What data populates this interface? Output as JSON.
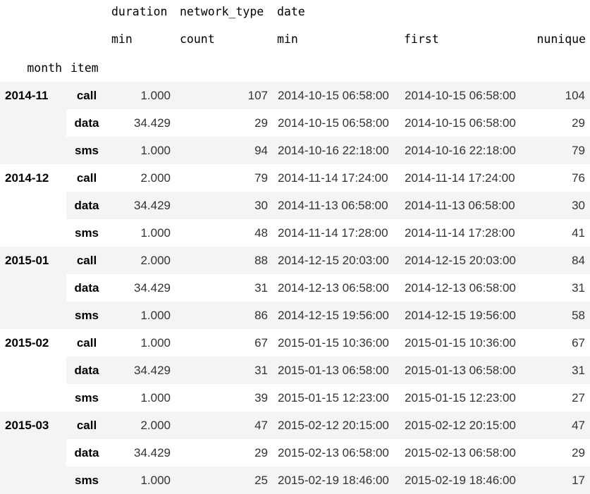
{
  "header": {
    "level0": {
      "duration": "duration",
      "network_type": "network_type",
      "date": "date"
    },
    "level1": {
      "duration_min": "min",
      "network_count": "count",
      "date_min": "min",
      "date_first": "first",
      "date_nunique": "nunique"
    },
    "index_names": {
      "month": "month",
      "item": "item"
    }
  },
  "groups": [
    {
      "month": "2014-11",
      "rows": [
        {
          "item": "call",
          "duration_min": "1.000",
          "count": "107",
          "date_min": "2014-10-15 06:58:00",
          "date_first": "2014-10-15 06:58:00",
          "nunique": "104"
        },
        {
          "item": "data",
          "duration_min": "34.429",
          "count": "29",
          "date_min": "2014-10-15 06:58:00",
          "date_first": "2014-10-15 06:58:00",
          "nunique": "29"
        },
        {
          "item": "sms",
          "duration_min": "1.000",
          "count": "94",
          "date_min": "2014-10-16 22:18:00",
          "date_first": "2014-10-16 22:18:00",
          "nunique": "79"
        }
      ]
    },
    {
      "month": "2014-12",
      "rows": [
        {
          "item": "call",
          "duration_min": "2.000",
          "count": "79",
          "date_min": "2014-11-14 17:24:00",
          "date_first": "2014-11-14 17:24:00",
          "nunique": "76"
        },
        {
          "item": "data",
          "duration_min": "34.429",
          "count": "30",
          "date_min": "2014-11-13 06:58:00",
          "date_first": "2014-11-13 06:58:00",
          "nunique": "30"
        },
        {
          "item": "sms",
          "duration_min": "1.000",
          "count": "48",
          "date_min": "2014-11-14 17:28:00",
          "date_first": "2014-11-14 17:28:00",
          "nunique": "41"
        }
      ]
    },
    {
      "month": "2015-01",
      "rows": [
        {
          "item": "call",
          "duration_min": "2.000",
          "count": "88",
          "date_min": "2014-12-15 20:03:00",
          "date_first": "2014-12-15 20:03:00",
          "nunique": "84"
        },
        {
          "item": "data",
          "duration_min": "34.429",
          "count": "31",
          "date_min": "2014-12-13 06:58:00",
          "date_first": "2014-12-13 06:58:00",
          "nunique": "31"
        },
        {
          "item": "sms",
          "duration_min": "1.000",
          "count": "86",
          "date_min": "2014-12-15 19:56:00",
          "date_first": "2014-12-15 19:56:00",
          "nunique": "58"
        }
      ]
    },
    {
      "month": "2015-02",
      "rows": [
        {
          "item": "call",
          "duration_min": "1.000",
          "count": "67",
          "date_min": "2015-01-15 10:36:00",
          "date_first": "2015-01-15 10:36:00",
          "nunique": "67"
        },
        {
          "item": "data",
          "duration_min": "34.429",
          "count": "31",
          "date_min": "2015-01-13 06:58:00",
          "date_first": "2015-01-13 06:58:00",
          "nunique": "31"
        },
        {
          "item": "sms",
          "duration_min": "1.000",
          "count": "39",
          "date_min": "2015-01-15 12:23:00",
          "date_first": "2015-01-15 12:23:00",
          "nunique": "27"
        }
      ]
    },
    {
      "month": "2015-03",
      "rows": [
        {
          "item": "call",
          "duration_min": "2.000",
          "count": "47",
          "date_min": "2015-02-12 20:15:00",
          "date_first": "2015-02-12 20:15:00",
          "nunique": "47"
        },
        {
          "item": "data",
          "duration_min": "34.429",
          "count": "29",
          "date_min": "2015-02-13 06:58:00",
          "date_first": "2015-02-13 06:58:00",
          "nunique": "29"
        },
        {
          "item": "sms",
          "duration_min": "1.000",
          "count": "25",
          "date_min": "2015-02-19 18:46:00",
          "date_first": "2015-02-19 18:46:00",
          "nunique": "17"
        }
      ]
    }
  ],
  "colors": {
    "stripe": "#f4f4f4",
    "background": "#ffffff",
    "text": "#000000"
  }
}
